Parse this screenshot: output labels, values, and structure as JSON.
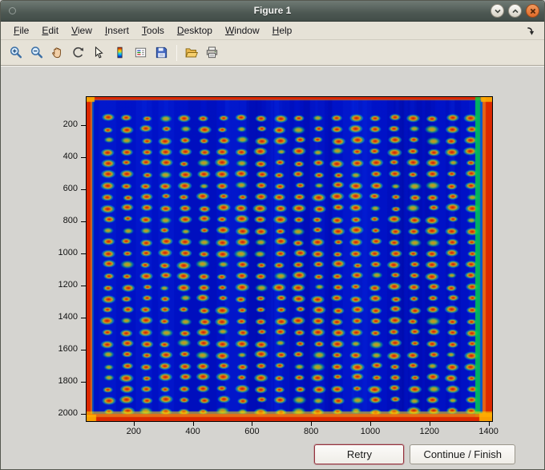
{
  "window": {
    "title": "Figure 1",
    "controls": {
      "minimize": "minimize",
      "maximize": "maximize",
      "close": "close"
    }
  },
  "menu": {
    "items": [
      "File",
      "Edit",
      "View",
      "Insert",
      "Tools",
      "Desktop",
      "Window",
      "Help"
    ]
  },
  "toolbar": {
    "icons": [
      "zoom-in",
      "zoom-out",
      "pan",
      "rotate-3d",
      "data-cursor",
      "insert-colorbar",
      "insert-legend",
      "save-figure",
      "open-file",
      "print-figure"
    ]
  },
  "figure": {
    "axes": {
      "x_ticks": [
        200,
        400,
        600,
        800,
        1000,
        1200,
        1400
      ],
      "y_ticks": [
        200,
        400,
        600,
        800,
        1000,
        1200,
        1400,
        1600,
        1800,
        2000
      ]
    },
    "image": {
      "description": "Microarray scan heatmap, jet colormap: deep blue background, regular grid of red-orange spots with yellow-green halos, bright red-orange border along all image edges and a green stripe near the right edge",
      "grid_rows": 27,
      "grid_cols": 20,
      "colors": {
        "background": "#0011c4",
        "spot_core": "#c01408",
        "spot_mid": "#ff8800",
        "spot_halo": "#30c860",
        "edge": "#dc2800",
        "right_stripe": "#00d746"
      }
    }
  },
  "actions": {
    "retry": "Retry",
    "continue": "Continue / Finish"
  }
}
